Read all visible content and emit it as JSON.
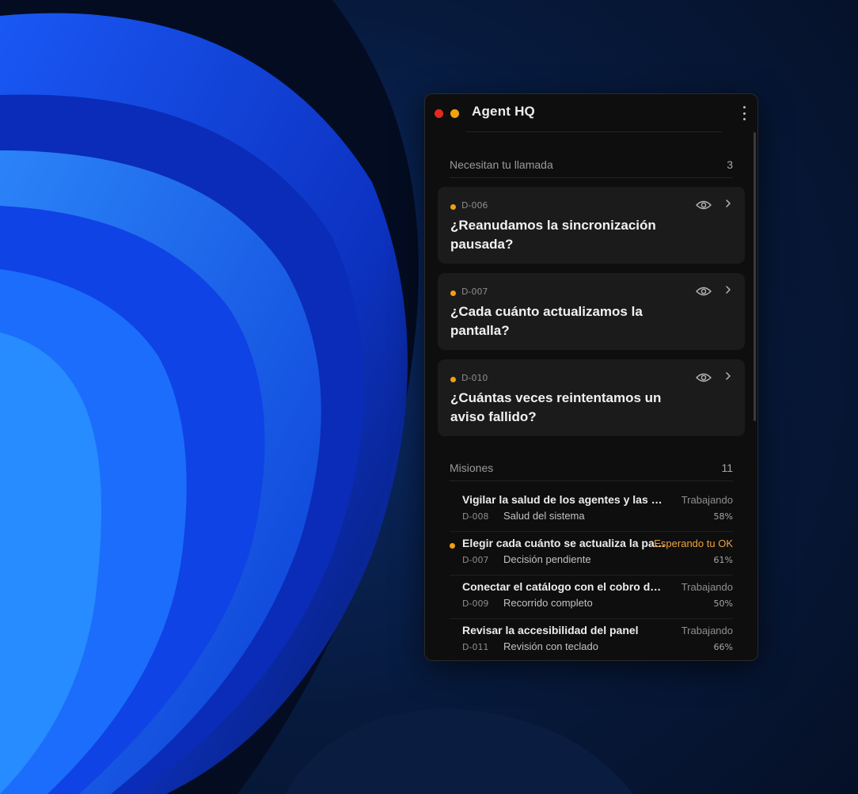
{
  "window": {
    "title": "Agent HQ"
  },
  "sections": {
    "attention": {
      "label": "Necesitan tu llamada",
      "count": "3"
    },
    "missions": {
      "label": "Misiones",
      "count": "11"
    }
  },
  "cards": [
    {
      "id": "D-006",
      "question": "¿Reanudamos la sincronización pausada?"
    },
    {
      "id": "D-007",
      "question": "¿Cada cuánto actualizamos la pantalla?"
    },
    {
      "id": "D-010",
      "question": "¿Cuántas veces reintentamos un aviso fallido?"
    }
  ],
  "missions": [
    {
      "title": "Vigilar la salud de los agentes y las herramientas",
      "status": "Trabajando",
      "id": "D-008",
      "subtitle": "Salud del sistema",
      "progress": "58%"
    },
    {
      "title": "Elegir cada cuánto se actualiza la pantalla",
      "status": "Esperando tu OK",
      "id": "D-007",
      "subtitle": "Decisión pendiente",
      "progress": "61%"
    },
    {
      "title": "Conectar el catálogo con el cobro de pedidos",
      "status": "Trabajando",
      "id": "D-009",
      "subtitle": "Recorrido completo",
      "progress": "50%"
    },
    {
      "title": "Revisar la accesibilidad del panel",
      "status": "Trabajando",
      "id": "D-011",
      "subtitle": "Revisión con teclado",
      "progress": "66%"
    }
  ],
  "colors": {
    "close_dot": "#e5281f",
    "minimize_dot": "#f3a10d",
    "pending_dot": "#f0a012",
    "waiting_status": "#f0a23a",
    "panel_bg": "#0e0e0f",
    "card_bg": "#1b1b1c"
  },
  "icons": {
    "card_view": "eye-icon",
    "card_open": "chevron-right-icon",
    "window_menu": "kebab-menu-icon"
  }
}
